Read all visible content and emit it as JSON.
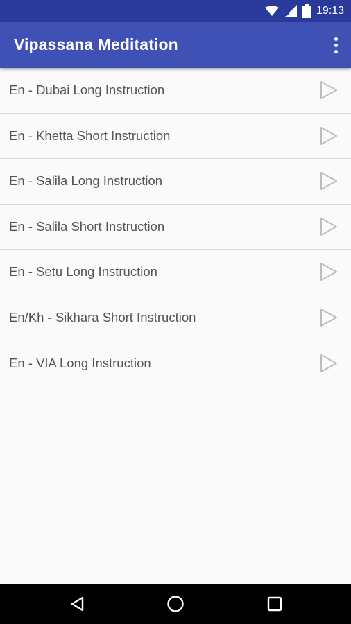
{
  "status_bar": {
    "time": "19:13",
    "icons": [
      "wifi-icon",
      "signal-icon",
      "battery-icon"
    ]
  },
  "app_bar": {
    "title": "Vipassana Meditation",
    "menu_icon": "more-vert-icon",
    "background": "#3f51b5"
  },
  "list": {
    "items": [
      {
        "label": "En - Dubai Long Instruction"
      },
      {
        "label": "En - Khetta Short Instruction"
      },
      {
        "label": "En - Salila Long Instruction"
      },
      {
        "label": "En - Salila Short Instruction"
      },
      {
        "label": "En - Setu Long Instruction"
      },
      {
        "label": "En/Kh - Sikhara Short Instruction"
      },
      {
        "label": "En - VIA Long Instruction"
      }
    ],
    "item_icon": "play-icon"
  },
  "nav_bar": {
    "buttons": [
      "back-icon",
      "home-icon",
      "recents-icon"
    ]
  }
}
